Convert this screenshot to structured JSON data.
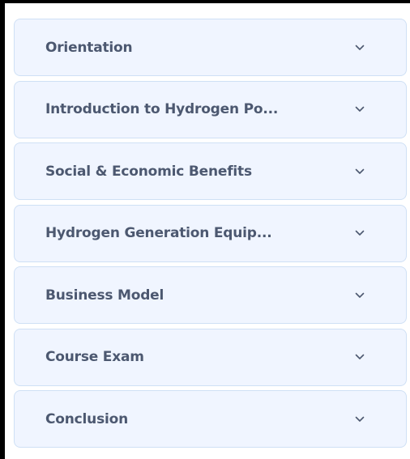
{
  "accordion": {
    "items": [
      {
        "label": "Orientation",
        "icon": "chevron-down-icon"
      },
      {
        "label": "Introduction to Hydrogen Po...",
        "icon": "chevron-down-icon"
      },
      {
        "label": "Social & Economic Benefits",
        "icon": "chevron-down-icon"
      },
      {
        "label": "Hydrogen Generation Equip...",
        "icon": "chevron-down-icon"
      },
      {
        "label": "Business Model",
        "icon": "chevron-down-icon"
      },
      {
        "label": "Course Exam",
        "icon": "chevron-down-icon"
      },
      {
        "label": "Conclusion",
        "icon": "chevron-down-icon"
      }
    ]
  },
  "colors": {
    "item_background": "#f0f5ff",
    "item_border": "#cfe0f5",
    "label_text": "#4c5870",
    "chevron": "#4c5870"
  }
}
